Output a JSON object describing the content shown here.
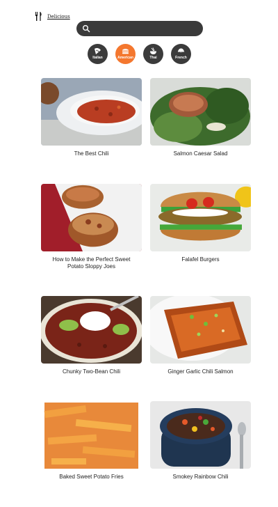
{
  "brand": {
    "name": "Delicious",
    "icon": "fork-knife-icon"
  },
  "search": {
    "placeholder": "",
    "value": "",
    "icon": "search-icon"
  },
  "categories": [
    {
      "label": "Italian",
      "icon": "pizza-icon",
      "active": false
    },
    {
      "label": "American",
      "icon": "burger-icon",
      "active": true
    },
    {
      "label": "Thai",
      "icon": "bowl-icon",
      "active": false
    },
    {
      "label": "French",
      "icon": "croissant-icon",
      "active": false
    }
  ],
  "recipes": [
    {
      "title": "The Best Chili"
    },
    {
      "title": "Salmon Caesar Salad"
    },
    {
      "title": "How to Make the Perfect Sweet Potato Sloppy Joes"
    },
    {
      "title": "Falafel Burgers"
    },
    {
      "title": "Chunky Two-Bean Chili"
    },
    {
      "title": "Ginger Garlic Chili Salmon"
    },
    {
      "title": "Baked Sweet Potato Fries"
    },
    {
      "title": "Smokey Rainbow Chili"
    }
  ],
  "colors": {
    "accent": "#f4772e",
    "dark": "#3a3a3a"
  }
}
